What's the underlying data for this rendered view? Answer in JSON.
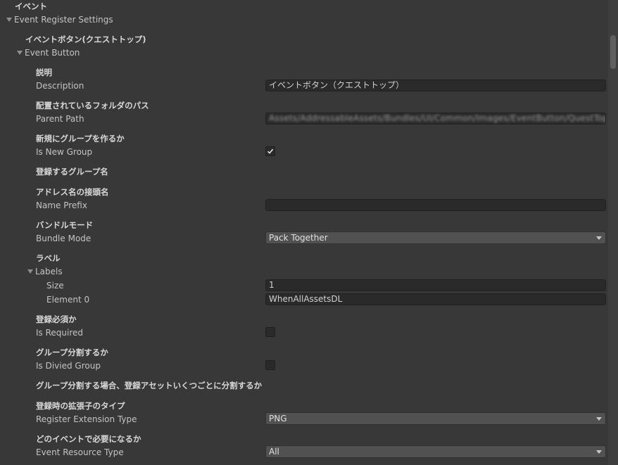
{
  "section_header": "イベント",
  "root_foldout": "Event Register Settings",
  "event_button_header": "イベントボタン(クエストトップ)",
  "event_button_foldout": "Event Button",
  "fields": {
    "description": {
      "header": "説明",
      "label": "Description",
      "value": "イベントボタン（クエストトップ）"
    },
    "parent_path": {
      "header": "配置されているフォルダのパス",
      "label": "Parent Path",
      "value": "Assets/AddressableAssets/Bundles/UI/Common/Images/EventButton/QuestTop"
    },
    "is_new_group": {
      "header": "新規にグループを作るか",
      "label": "Is New Group",
      "checked": true
    },
    "group_name": {
      "header": "登録するグループ名"
    },
    "name_prefix": {
      "header": "アドレス名の接頭名",
      "label": "Name Prefix",
      "value": ""
    },
    "bundle_mode": {
      "header": "バンドルモード",
      "label": "Bundle Mode",
      "value": "Pack Together"
    },
    "labels": {
      "header": "ラベル",
      "label": "Labels",
      "size_label": "Size",
      "size_value": "1",
      "element_label": "Element 0",
      "element_value": "WhenAllAssetsDL"
    },
    "is_required": {
      "header": "登録必須か",
      "label": "Is Required",
      "checked": false
    },
    "is_divied_group": {
      "header": "グループ分割するか",
      "label": "Is Divied Group",
      "checked": false
    },
    "divide_note": {
      "header": "グループ分割する場合、登録アセットいくつごとに分割するか"
    },
    "register_extension_type": {
      "header": "登録時の拡張子のタイプ",
      "label": "Register Extension Type",
      "value": "PNG"
    },
    "event_resource_type": {
      "header": "どのイベントで必要になるか",
      "label": "Event Resource Type",
      "value": "All"
    }
  },
  "icons": {
    "foldout": "triangle-down-icon",
    "checkmark": "checkmark-icon",
    "dropdown": "dropdown-arrow-icon"
  },
  "colors": {
    "background": "#383838",
    "field_background": "#2a2a2a",
    "dropdown_background": "#515151",
    "text": "#c4c4c4"
  }
}
